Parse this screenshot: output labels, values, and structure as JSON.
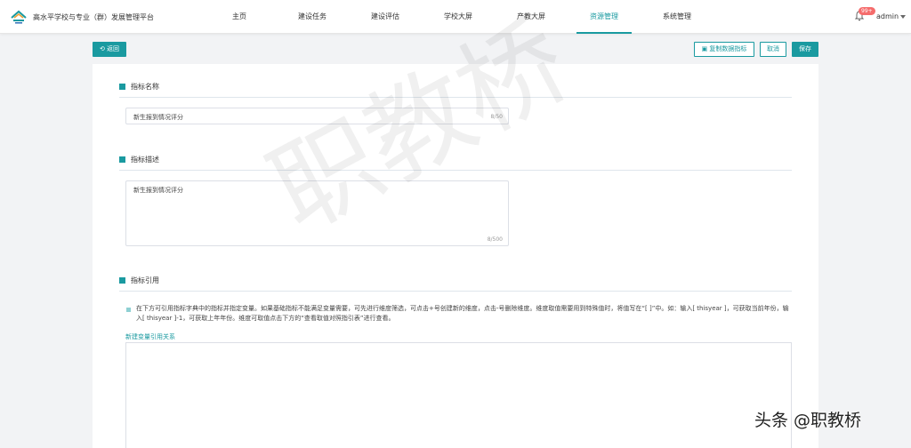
{
  "header": {
    "app_title": "高水平学校与专业（群）发展管理平台",
    "nav": [
      {
        "label": "主页",
        "active": false
      },
      {
        "label": "建设任务",
        "active": false
      },
      {
        "label": "建设评估",
        "active": false
      },
      {
        "label": "学校大屏",
        "active": false
      },
      {
        "label": "产教大屏",
        "active": false
      },
      {
        "label": "资源管理",
        "active": true
      },
      {
        "label": "系统管理",
        "active": false
      }
    ],
    "badge": "99+",
    "user": "admin",
    "icons": {
      "bell": "bell-icon",
      "caret": "caret-down-icon"
    }
  },
  "toolbar": {
    "back_label": "返回",
    "copy_label": "复制数据指标",
    "cancel_label": "取消",
    "save_label": "保存"
  },
  "sections": {
    "name": {
      "title": "指标名称",
      "value": "新生报到情况评分",
      "count": "8/50"
    },
    "description": {
      "title": "指标描述",
      "value": "新生报到情况评分",
      "count": "8/500"
    },
    "reference": {
      "title": "指标引用",
      "tip": "在下方可引用指标字典中的指标并指定变量。如果基础指标不能满足变量需要，可先进行维度筛选，可点击+号创建新的维度，点击-号删除维度。维度取值需要用到特殊值时，将值写在“[ ]”中。如：输入[ thisyear ]，可获取当前年份，输入[ thisyear ]-1，可获取上年年份。维度可取值点击下方的“查看取值对照指引表”进行查看。",
      "new_link": "新建变量引用关系"
    }
  },
  "watermarks": {
    "center": "职教桥",
    "corner": "头条 @职教桥"
  },
  "colors": {
    "accent": "#1a9aa0",
    "badge": "#f56c6c"
  }
}
